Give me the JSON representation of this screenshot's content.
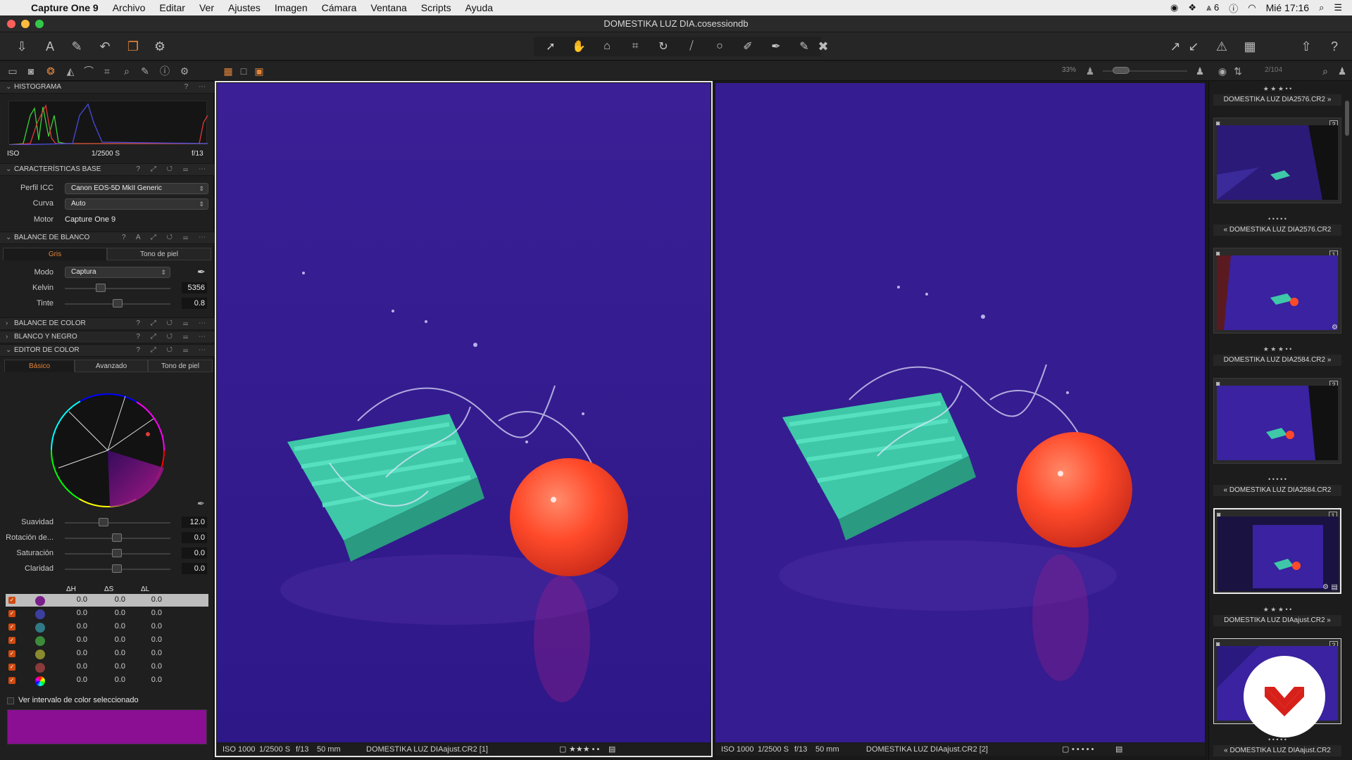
{
  "menubar": {
    "app": "Capture One 9",
    "items": [
      "Archivo",
      "Editar",
      "Ver",
      "Ajustes",
      "Imagen",
      "Cámara",
      "Ventana",
      "Scripts",
      "Ayuda"
    ],
    "status_count": "6",
    "clock": "Mié 17:16"
  },
  "window": {
    "title": "DOMESTIKA LUZ DIA.cosessiondb"
  },
  "viewer_header": {
    "zoom": "33%",
    "counter": "2/104"
  },
  "histogram": {
    "title": "HISTOGRAMA",
    "iso_label": "ISO",
    "shutter": "1/2500 S",
    "aperture": "f/13"
  },
  "base": {
    "title": "CARACTERÍSTICAS BASE",
    "icc_label": "Perfil ICC",
    "icc_value": "Canon EOS-5D MkII Generic",
    "curve_label": "Curva",
    "curve_value": "Auto",
    "engine_label": "Motor",
    "engine_value": "Capture One 9"
  },
  "wb": {
    "title": "BALANCE DE BLANCO",
    "tab_gray": "Gris",
    "tab_skin": "Tono de piel",
    "mode_label": "Modo",
    "mode_value": "Captura",
    "kelvin_label": "Kelvin",
    "kelvin_value": "5356",
    "tint_label": "Tinte",
    "tint_value": "0.8"
  },
  "collapsed": {
    "color_balance": "BALANCE DE COLOR",
    "bw": "BLANCO Y NEGRO"
  },
  "color_editor": {
    "title": "EDITOR DE COLOR",
    "tabs": [
      "Básico",
      "Avanzado",
      "Tono de piel"
    ],
    "sliders": [
      {
        "label": "Suavidad",
        "value": "12.0"
      },
      {
        "label": "Rotación de...",
        "value": "0.0"
      },
      {
        "label": "Saturación",
        "value": "0.0"
      },
      {
        "label": "Claridad",
        "value": "0.0"
      }
    ],
    "headers": [
      "ΔH",
      "ΔS",
      "ΔL"
    ],
    "rows": [
      {
        "color": "#7a1f8a",
        "h": "0.0",
        "s": "0.0",
        "l": "0.0"
      },
      {
        "color": "#3b3f9e",
        "h": "0.0",
        "s": "0.0",
        "l": "0.0"
      },
      {
        "color": "#2f7a86",
        "h": "0.0",
        "s": "0.0",
        "l": "0.0"
      },
      {
        "color": "#3c8a3a",
        "h": "0.0",
        "s": "0.0",
        "l": "0.0"
      },
      {
        "color": "#8a8a2e",
        "h": "0.0",
        "s": "0.0",
        "l": "0.0"
      },
      {
        "color": "#8a3a3a",
        "h": "0.0",
        "s": "0.0",
        "l": "0.0"
      },
      {
        "color": "rainbow",
        "h": "0.0",
        "s": "0.0",
        "l": "0.0"
      }
    ],
    "show_range_label": "Ver intervalo de color seleccionado",
    "swatch_color": "#8a0f92"
  },
  "viewers": [
    {
      "iso": "ISO 1000",
      "shutter": "1/2500 S",
      "aperture": "f/13",
      "focal": "50 mm",
      "name": "DOMESTIKA LUZ DIAajust.CR2 [1]",
      "rating": "★★★ • •"
    },
    {
      "iso": "ISO 1000",
      "shutter": "1/2500 S",
      "aperture": "f/13",
      "focal": "50 mm",
      "name": "DOMESTIKA LUZ DIAajust.CR2 [2]",
      "rating": "• • • • •"
    }
  ],
  "browser": [
    {
      "stars": "★ ★ ★ • •",
      "name": "DOMESTIKA LUZ DIA2576.CR2",
      "badge": "2",
      "arrow": "»"
    },
    {
      "stars": "• • • • •",
      "name": "DOMESTIKA LUZ DIA2576.CR2",
      "badge": "1",
      "arrow": "«"
    },
    {
      "stars": "★ ★ ★ • •",
      "name": "DOMESTIKA LUZ DIA2584.CR2",
      "badge": "2",
      "arrow": "»"
    },
    {
      "stars": "• • • • •",
      "name": "DOMESTIKA LUZ DIA2584.CR2",
      "badge": "1",
      "arrow": "«"
    },
    {
      "stars": "★ ★ ★ • •",
      "name": "DOMESTIKA LUZ DIAajust.CR2",
      "badge": "2",
      "arrow": "»"
    },
    {
      "stars": "• • • • •",
      "name": "DOMESTIKA LUZ DIAajust.CR2",
      "badge": "",
      "arrow": "«"
    }
  ],
  "colors": {
    "accent_orange": "#e2853a",
    "image_bg": "#3a2090",
    "ball": "#ff5a3a",
    "block": "#3ec8a8",
    "logo_red": "#d8201a"
  }
}
